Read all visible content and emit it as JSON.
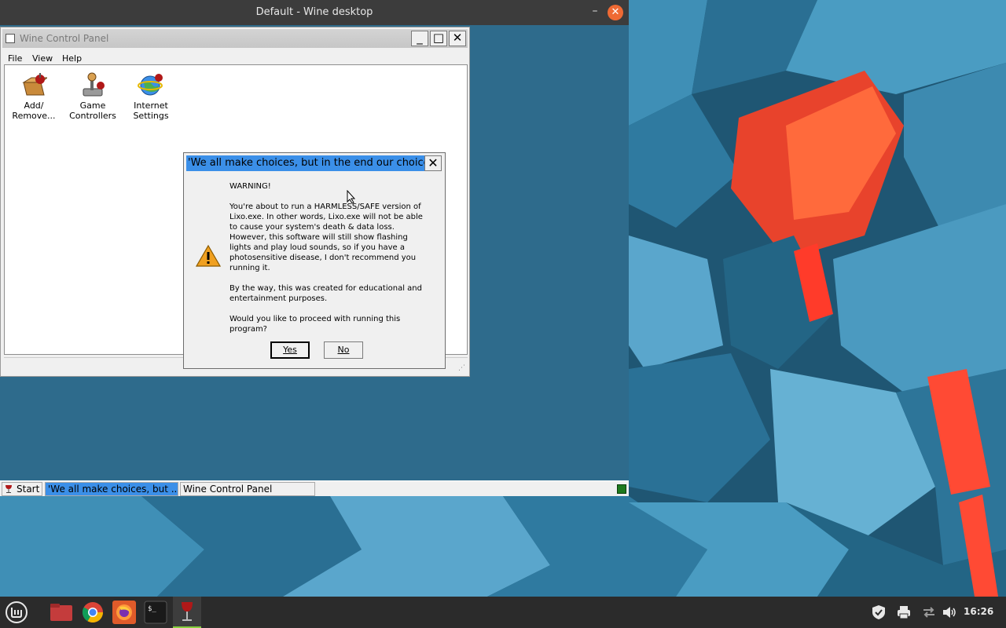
{
  "wine_desktop": {
    "title": "Default - Wine desktop",
    "minimize_symbol": "–",
    "close_symbol": "✕"
  },
  "control_panel": {
    "title": "Wine Control Panel",
    "menu": [
      "File",
      "View",
      "Help"
    ],
    "items": [
      {
        "label_line1": "Add/",
        "label_line2": "Remove...",
        "icon": "add-remove-programs-icon"
      },
      {
        "label_line1": "Game",
        "label_line2": "Controllers",
        "icon": "game-controller-icon"
      },
      {
        "label_line1": "Internet",
        "label_line2": "Settings",
        "icon": "internet-settings-icon"
      }
    ],
    "buttons": {
      "minimize": "_",
      "maximize": "□",
      "close": "✕"
    }
  },
  "dialog": {
    "title": "'We all make choices, but in the end our choices make us.'",
    "close_symbol": "✕",
    "heading": "WARNING!",
    "paragraph1": "You're about to run a HARMLESS/SAFE version of Lixo.exe. In other words, Lixo.exe will not be able to cause your system's death & data loss. However, this software will still show flashing lights and play loud sounds, so if you have a photosensitive disease, I don't recommend you running it.",
    "paragraph2": "By the way, this was created for educational and entertainment purposes.",
    "paragraph3": "Would you like to proceed with running this program?",
    "yes_label": "Yes",
    "no_label": "No",
    "icon": "warning-icon"
  },
  "wine_taskbar": {
    "start_label": "Start",
    "tasks": [
      "'We all make choices, but ...",
      "Wine Control Panel"
    ]
  },
  "panel": {
    "clock": "16:26",
    "launchers": [
      "mint-menu-icon",
      "files-icon",
      "chrome-icon",
      "firefox-icon",
      "terminal-icon",
      "wine-icon"
    ],
    "tray": [
      "shield-icon",
      "printer-icon",
      "network-icon",
      "volume-icon"
    ]
  },
  "colors": {
    "accent": "#3b8fe8",
    "close_orange": "#ef6a34",
    "panel": "#2b2b2b",
    "desktop_teal": "#2e6b8c"
  }
}
